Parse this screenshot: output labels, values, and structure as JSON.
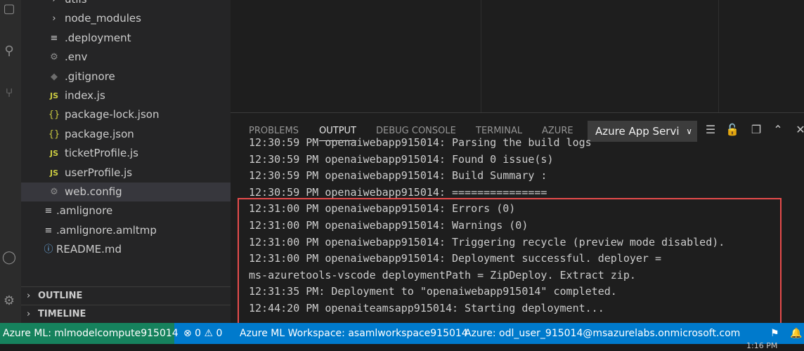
{
  "explorer": {
    "items": [
      {
        "label": "utils",
        "icon": "chevron-right-icon"
      },
      {
        "label": "node_modules",
        "icon": "chevron-right-icon"
      },
      {
        "label": ".deployment",
        "icon": "lines-icon"
      },
      {
        "label": ".env",
        "icon": "gear-icon"
      },
      {
        "label": ".gitignore",
        "icon": "diamond-icon"
      },
      {
        "label": "index.js",
        "icon": "js-icon"
      },
      {
        "label": "package-lock.json",
        "icon": "braces-icon"
      },
      {
        "label": "package.json",
        "icon": "braces-icon"
      },
      {
        "label": "ticketProfile.js",
        "icon": "js-icon"
      },
      {
        "label": "userProfile.js",
        "icon": "js-icon"
      },
      {
        "label": "web.config",
        "icon": "gear-icon"
      },
      {
        "label": ".amlignore",
        "icon": "lines-icon"
      },
      {
        "label": ".amlignore.amltmp",
        "icon": "lines-icon"
      },
      {
        "label": "README.md",
        "icon": "info-icon"
      }
    ],
    "glyphs": {
      "js": "JS",
      "braces": "{}",
      "lines": "≡",
      "gear": "⚙",
      "diamond": "◆",
      "info": "ⓘ",
      "chevron": "›"
    },
    "outline": "OUTLINE",
    "timeline": "TIMELINE"
  },
  "panel": {
    "tabs": [
      "PROBLEMS",
      "OUTPUT",
      "DEBUG CONSOLE",
      "TERMINAL",
      "AZURE"
    ],
    "active_tab": "OUTPUT",
    "channel": "Azure App Servi",
    "output_lines": [
      "12:30:59 PM openaiwebapp915014: Parsing the build logs",
      "12:30:59 PM openaiwebapp915014: Found 0 issue(s)",
      "12:30:59 PM openaiwebapp915014: Build Summary :",
      "12:30:59 PM openaiwebapp915014: ===============",
      "12:31:00 PM openaiwebapp915014: Errors (0)",
      "12:31:00 PM openaiwebapp915014: Warnings (0)",
      "12:31:00 PM openaiwebapp915014: Triggering recycle (preview mode disabled).",
      "12:31:00 PM openaiwebapp915014: Deployment successful. deployer =",
      "ms-azuretools-vscode deploymentPath = ZipDeploy. Extract zip.",
      "12:31:35 PM: Deployment to \"openaiwebapp915014\" completed.",
      "12:44:20 PM openaiteamsapp915014: Starting deployment..."
    ]
  },
  "status": {
    "remote": "Azure ML: mlmodelcompute915014",
    "problems": "⊗ 0 ⚠ 0",
    "workspace": "Azure ML Workspace: asamlworkspace915014",
    "account": "Azure: odl_user_915014@msazurelabs.onmicrosoft.com",
    "clock": "1:16 PM"
  },
  "colors": {
    "status_bar": "#007acc",
    "remote_indicator": "#16825d",
    "highlight_box": "#e74c4c",
    "js_icon": "#cbcb41",
    "json_icon": "#cbcb41"
  }
}
